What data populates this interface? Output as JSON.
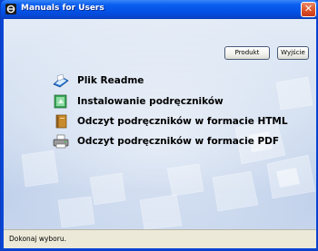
{
  "window": {
    "title": "Manuals for Users",
    "close_glyph": "✕"
  },
  "buttons": {
    "produkt": "Produkt",
    "wyjscie": "Wyjście"
  },
  "menu": [
    {
      "label": "Plik Readme",
      "icon": "readme-icon"
    },
    {
      "label": "Instalowanie podręczników",
      "icon": "install-icon"
    },
    {
      "label": "Odczyt podręczników w formacie HTML",
      "icon": "html-book-icon"
    },
    {
      "label": "Odczyt podręczników w formacie PDF",
      "icon": "pdf-printer-icon"
    }
  ],
  "status": {
    "text": "Dokonaj wyboru."
  },
  "colors": {
    "title_bar": "#0352e6",
    "client_bg": "#cfdcef",
    "status_bar": "#ece9d8",
    "close_button": "#e25a2e"
  }
}
